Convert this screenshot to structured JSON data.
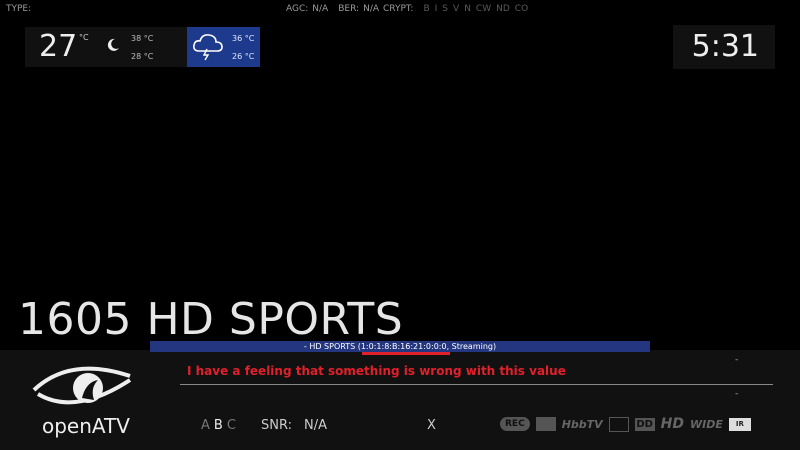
{
  "top_bar": {
    "type_label": "TYPE:",
    "agc_label": "AGC:",
    "agc_value": "N/A",
    "ber_label": "BER:",
    "ber_value": "N/A",
    "crypt_label": "CRYPT:",
    "crypt_flags": [
      "B",
      "I",
      "S",
      "V",
      "N",
      "CW",
      "ND",
      "CO"
    ]
  },
  "weather": {
    "current_temp": "27",
    "current_unit": "°C",
    "current_icon": "moon-icon",
    "today_high": "38 °C",
    "today_low": "28 °C",
    "forecast_icon": "storm-cloud-icon",
    "forecast_high": "36 °C",
    "forecast_low": "26 °C",
    "forecast_bg": "#1e3a8c"
  },
  "clock": {
    "time": "5:31"
  },
  "channel": {
    "name": "1605 HD SPORTS",
    "service_info": "- HD SPORTS (1:0:1:8:B:16:21:0:0:0, Streaming)"
  },
  "annotation": {
    "text": "I have a feeling that something is wrong with this value",
    "color": "#e0202a"
  },
  "infobar": {
    "dash_now": "-",
    "dash_next": "-",
    "logo_text": "openATV",
    "abc": [
      "A",
      "B",
      "C"
    ],
    "snr_label": "SNR:",
    "snr_value": "N/A",
    "x_mark": "X",
    "indicator_icons": [
      {
        "name": "rec-icon",
        "label": "REC"
      },
      {
        "name": "epg-icon",
        "label": ""
      },
      {
        "name": "hbbtv-icon",
        "label": "HbbTV"
      },
      {
        "name": "teletext-icon",
        "label": ""
      },
      {
        "name": "dolby-icon",
        "label": "DD"
      },
      {
        "name": "hd-icon",
        "label": "HD"
      },
      {
        "name": "wide-icon",
        "label": "WIDE"
      },
      {
        "name": "subtitle-icon",
        "label": "IR"
      }
    ]
  }
}
